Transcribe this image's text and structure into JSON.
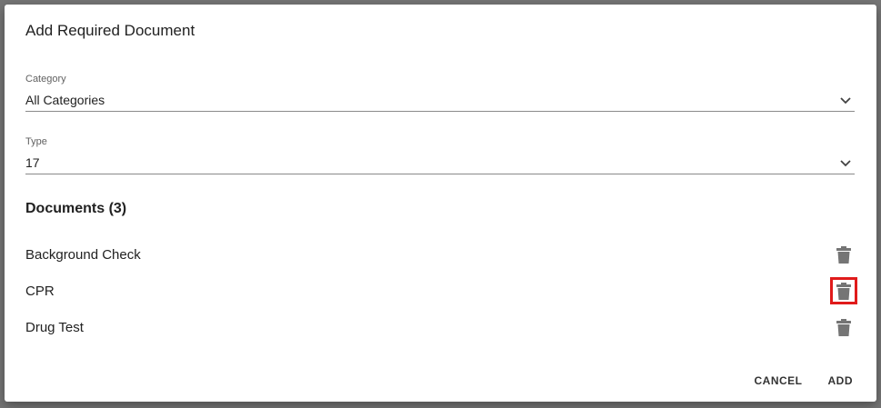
{
  "dialog": {
    "title": "Add Required Document",
    "category": {
      "label": "Category",
      "value": "All Categories"
    },
    "type": {
      "label": "Type",
      "value": "17"
    },
    "documents_heading": "Documents (3)",
    "documents": [
      {
        "name": "Background Check",
        "action_icon": "trash-icon"
      },
      {
        "name": "CPR",
        "action_icon": "trash-icon",
        "highlighted": true
      },
      {
        "name": "Drug Test",
        "action_icon": "trash-icon"
      }
    ],
    "buttons": {
      "cancel": "CANCEL",
      "add": "ADD"
    }
  },
  "colors": {
    "overlay": "#757575",
    "icon": "#757575",
    "highlight": "#e01b1b",
    "text": "#212121"
  }
}
